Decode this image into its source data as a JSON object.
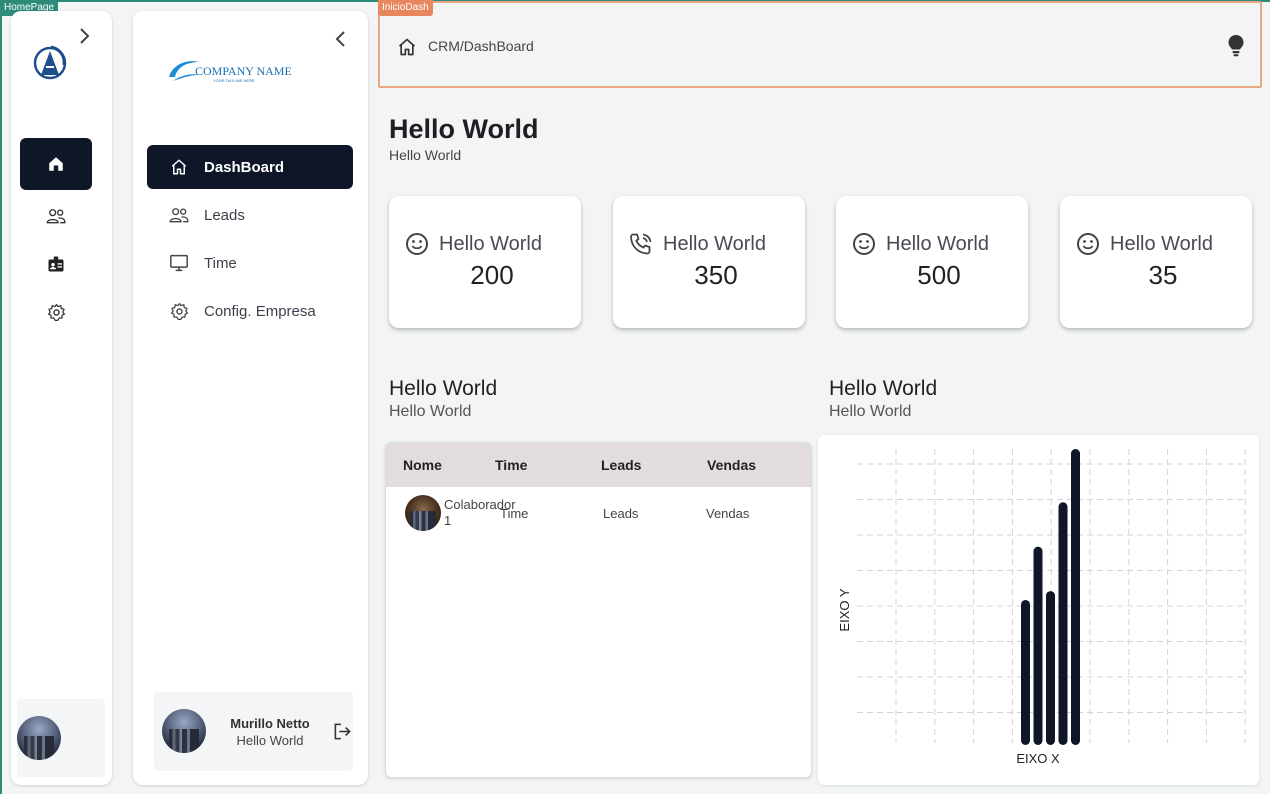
{
  "tags": {
    "homepage": "HomePage",
    "dash": "InicioDash"
  },
  "rail": {
    "items": [
      {
        "icon": "home-icon",
        "active": true
      },
      {
        "icon": "users-icon",
        "active": false
      },
      {
        "icon": "badge-icon",
        "active": false
      },
      {
        "icon": "gear-icon",
        "active": false
      }
    ]
  },
  "sidebar": {
    "brand_name": "COMPANY NAME",
    "brand_tagline": "YOUR TAGLINE HERE",
    "items": [
      {
        "label": "DashBoard",
        "icon": "home-icon",
        "active": true
      },
      {
        "label": "Leads",
        "icon": "users-icon",
        "active": false
      },
      {
        "label": "Time",
        "icon": "monitor-icon",
        "active": false
      },
      {
        "label": "Config. Empresa",
        "icon": "gear-icon",
        "active": false
      }
    ],
    "user": {
      "name": "Murillo Netto",
      "role": "Hello World"
    }
  },
  "topbar": {
    "breadcrumb": "CRM/DashBoard"
  },
  "page": {
    "title": "Hello World",
    "subtitle": "Hello World"
  },
  "cards": [
    {
      "title": "Hello World",
      "value": "200",
      "icon": "smile-icon"
    },
    {
      "title": "Hello World",
      "value": "350",
      "icon": "phone-call-icon"
    },
    {
      "title": "Hello World",
      "value": "500",
      "icon": "smile-icon"
    },
    {
      "title": "Hello World",
      "value": "35",
      "icon": "smile-icon"
    }
  ],
  "table_section": {
    "title": "Hello World",
    "subtitle": "Hello World"
  },
  "chart_section": {
    "title": "Hello World",
    "subtitle": "Hello World"
  },
  "table": {
    "headers": [
      "Nome",
      "Time",
      "Leads",
      "Vendas"
    ],
    "rows": [
      {
        "nome": "Colaborador 1",
        "time": "Time",
        "leads": "Leads",
        "vendas": "Vendas"
      }
    ]
  },
  "chart_data": {
    "type": "bar",
    "xlabel": "EIXO X",
    "ylabel": "EIXO Y",
    "values": [
      0.49,
      0.67,
      0.52,
      0.82,
      1.0
    ],
    "grid": true
  },
  "colors": {
    "primary": "#0e1628",
    "accent_border": "#e8a684",
    "frame": "#2e8b7a"
  }
}
